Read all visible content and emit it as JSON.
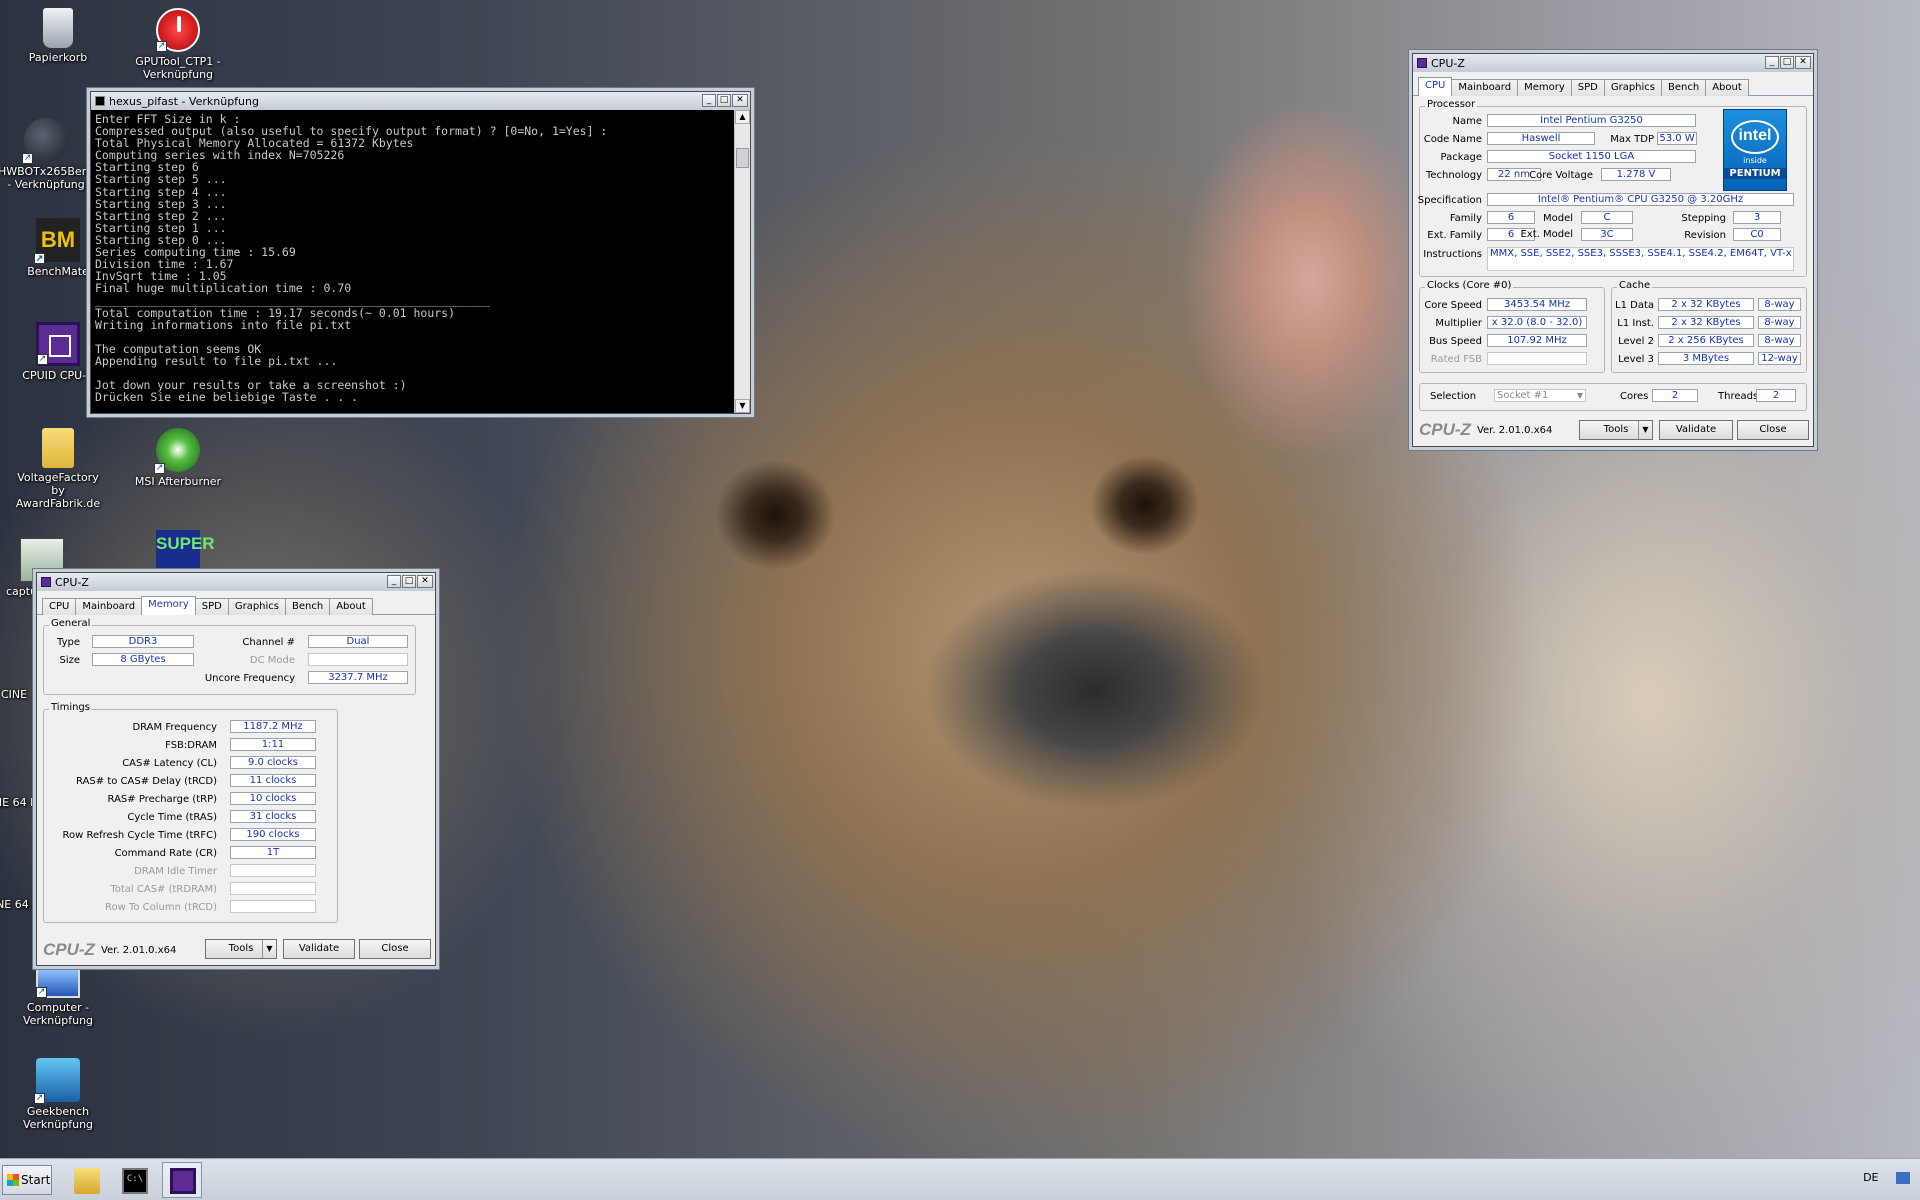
{
  "desktop_icons": [
    {
      "label": "Papierkorb",
      "icon": "recycle-bin-icon"
    },
    {
      "label": "GPUTool_CTP1 - Verknüpfung",
      "icon": "gputool-icon"
    },
    {
      "label": "HWBOTx265Bench - Verknüpfung",
      "icon": "hwbot-icon"
    },
    {
      "label": "BenchMate",
      "icon": "benchmate-icon"
    },
    {
      "label": "CPUID CPU-Z",
      "icon": "cpuz-icon"
    },
    {
      "label": "VoltageFactory by AwardFabrik.de",
      "icon": "folder-icon"
    },
    {
      "label": "MSI Afterburner",
      "icon": "afterburner-icon"
    },
    {
      "label": "captu",
      "icon": "capture-icon"
    },
    {
      "label": "",
      "icon": "superpi-icon"
    },
    {
      "label": "CINE",
      "icon": "cinebench-icon"
    },
    {
      "label": "CINE 64 Bit",
      "icon": "cinebench-icon"
    },
    {
      "label": "CINE 64 Bi",
      "icon": "cinebench-icon"
    },
    {
      "label": "Computer - Verknüpfung",
      "icon": "computer-icon"
    },
    {
      "label": "Geekbench Verknüpfung",
      "icon": "geekbench-icon"
    }
  ],
  "console": {
    "title": "hexus_pifast - Verknüpfung",
    "lines": [
      "Enter FFT Size in k :",
      "Compressed output (also useful to specify output format) ? [0=No, 1=Yes] :",
      "Total Physical Memory Allocated = 61372 Kbytes",
      "Computing series with index N=705226",
      "Starting step 6",
      "Starting step 5 ...",
      "Starting step 4 ...",
      "Starting step 3 ...",
      "Starting step 2 ...",
      "Starting step 1 ...",
      "Starting step 0 ...",
      "Series computing time : 15.69",
      "Division time : 1.67",
      "InvSqrt time : 1.05",
      "Final huge multiplication time : 0.70",
      "_________________________________________________________",
      "Total computation time : 19.17 seconds(~ 0.01 hours)",
      "Writing informations into file pi.txt",
      "",
      "The computation seems OK",
      "Appending result to file pi.txt ...",
      "",
      "Jot down your results or take a screenshot :)",
      "Drücken Sie eine beliebige Taste . . ."
    ]
  },
  "cpuz_cpu": {
    "title": "CPU-Z",
    "tabs": [
      "CPU",
      "Mainboard",
      "Memory",
      "SPD",
      "Graphics",
      "Bench",
      "About"
    ],
    "active_tab": "CPU",
    "processor": {
      "group": "Processor",
      "name_label": "Name",
      "name": "Intel Pentium G3250",
      "codename_label": "Code Name",
      "codename": "Haswell",
      "tdp_label": "Max TDP",
      "tdp": "53.0 W",
      "package_label": "Package",
      "package": "Socket 1150 LGA",
      "tech_label": "Technology",
      "tech": "22 nm",
      "voltage_label": "Core Voltage",
      "voltage": "1.278 V",
      "spec_label": "Specification",
      "spec": "Intel® Pentium® CPU G3250 @ 3.20GHz",
      "family_label": "Family",
      "family": "6",
      "model_label": "Model",
      "model": "C",
      "stepping_label": "Stepping",
      "stepping": "3",
      "extfamily_label": "Ext. Family",
      "extfamily": "6",
      "extmodel_label": "Ext. Model",
      "extmodel": "3C",
      "revision_label": "Revision",
      "revision": "C0",
      "instr_label": "Instructions",
      "instr": "MMX, SSE, SSE2, SSE3, SSSE3, SSE4.1, SSE4.2, EM64T, VT-x"
    },
    "logo": {
      "brand": "intel",
      "inside": "inside",
      "product": "PENTIUM"
    },
    "clocks": {
      "group": "Clocks (Core #0)",
      "core_label": "Core Speed",
      "core": "3453.54 MHz",
      "mult_label": "Multiplier",
      "mult": "x 32.0 (8.0 - 32.0)",
      "bus_label": "Bus Speed",
      "bus": "107.92 MHz",
      "fsb_label": "Rated FSB",
      "fsb": ""
    },
    "cache": {
      "group": "Cache",
      "l1d_label": "L1 Data",
      "l1d": "2 x 32 KBytes",
      "l1d_way": "8-way",
      "l1i_label": "L1 Inst.",
      "l1i": "2 x 32 KBytes",
      "l1i_way": "8-way",
      "l2_label": "Level 2",
      "l2": "2 x 256 KBytes",
      "l2_way": "8-way",
      "l3_label": "Level 3",
      "l3": "3 MBytes",
      "l3_way": "12-way"
    },
    "selection_label": "Selection",
    "selection": "Socket #1",
    "cores_label": "Cores",
    "cores": "2",
    "threads_label": "Threads",
    "threads": "2",
    "brand": "CPU-Z",
    "version": "Ver. 2.01.0.x64",
    "tools": "Tools",
    "validate": "Validate",
    "close": "Close"
  },
  "cpuz_mem": {
    "title": "CPU-Z",
    "tabs": [
      "CPU",
      "Mainboard",
      "Memory",
      "SPD",
      "Graphics",
      "Bench",
      "About"
    ],
    "active_tab": "Memory",
    "general": {
      "group": "General",
      "type_label": "Type",
      "type": "DDR3",
      "size_label": "Size",
      "size": "8 GBytes",
      "channel_label": "Channel #",
      "channel": "Dual",
      "dcmode_label": "DC Mode",
      "dcmode": "",
      "uncore_label": "Uncore Frequency",
      "uncore": "3237.7 MHz"
    },
    "timings": {
      "group": "Timings",
      "rows": [
        {
          "label": "DRAM Frequency",
          "value": "1187.2 MHz",
          "disabled": false
        },
        {
          "label": "FSB:DRAM",
          "value": "1:11",
          "disabled": false
        },
        {
          "label": "CAS# Latency (CL)",
          "value": "9.0 clocks",
          "disabled": false
        },
        {
          "label": "RAS# to CAS# Delay (tRCD)",
          "value": "11 clocks",
          "disabled": false
        },
        {
          "label": "RAS# Precharge (tRP)",
          "value": "10 clocks",
          "disabled": false
        },
        {
          "label": "Cycle Time (tRAS)",
          "value": "31 clocks",
          "disabled": false
        },
        {
          "label": "Row Refresh Cycle Time (tRFC)",
          "value": "190 clocks",
          "disabled": false
        },
        {
          "label": "Command Rate (CR)",
          "value": "1T",
          "disabled": false
        },
        {
          "label": "DRAM Idle Timer",
          "value": "",
          "disabled": true
        },
        {
          "label": "Total CAS# (tRDRAM)",
          "value": "",
          "disabled": true
        },
        {
          "label": "Row To Column (tRCD)",
          "value": "",
          "disabled": true
        }
      ]
    },
    "brand": "CPU-Z",
    "version": "Ver. 2.01.0.x64",
    "tools": "Tools",
    "validate": "Validate",
    "close": "Close"
  },
  "taskbar": {
    "start": "Start",
    "items": [
      "explorer",
      "console",
      "cpuz"
    ],
    "lang": "DE"
  }
}
